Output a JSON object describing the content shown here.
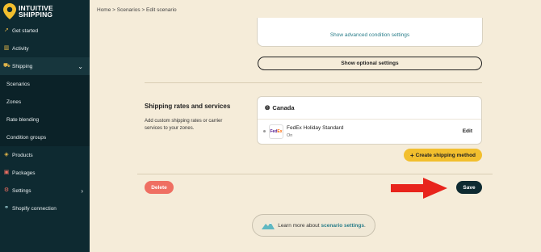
{
  "app": {
    "logo_line1": "INTUITIVE",
    "logo_line2": "SHIPPING"
  },
  "colors": {
    "sidebar": "#0e2a31",
    "accent_yellow": "#f2bf2e",
    "delete_red": "#ef6f62",
    "link_teal": "#2a7e8a",
    "arrow_red": "#e8241c"
  },
  "sidebar": {
    "items": [
      {
        "label": "Get started",
        "icon": "rocket-icon"
      },
      {
        "label": "Activity",
        "icon": "chart-icon"
      },
      {
        "label": "Shipping",
        "icon": "truck-icon"
      },
      {
        "label": "Scenarios"
      },
      {
        "label": "Zones"
      },
      {
        "label": "Rate blending"
      },
      {
        "label": "Condition groups"
      },
      {
        "label": "Products",
        "icon": "box-icon"
      },
      {
        "label": "Packages",
        "icon": "package-icon"
      },
      {
        "label": "Settings",
        "icon": "gear-icon"
      },
      {
        "label": "Shopify connection",
        "icon": "link-icon"
      }
    ]
  },
  "breadcrumb": {
    "text": "Home > Scenarios > Edit scenario"
  },
  "conditions": {
    "advanced_link": "Show advanced condition settings"
  },
  "optional_settings_label": "Show optional settings",
  "rates_section": {
    "title": "Shipping rates and services",
    "description": "Add custom shipping rates or carrier services to your zones.",
    "zone_name": "Canada",
    "service": {
      "logo_fe": "Fed",
      "logo_ex": "Ex",
      "name": "FedEx Holiday Standard",
      "status": "On",
      "edit_label": "Edit"
    },
    "create_label": "Create shipping method"
  },
  "actions": {
    "delete_label": "Delete",
    "save_label": "Save"
  },
  "learn_more": {
    "prefix": "Learn more about",
    "link": "scenario settings",
    "suffix": "."
  }
}
